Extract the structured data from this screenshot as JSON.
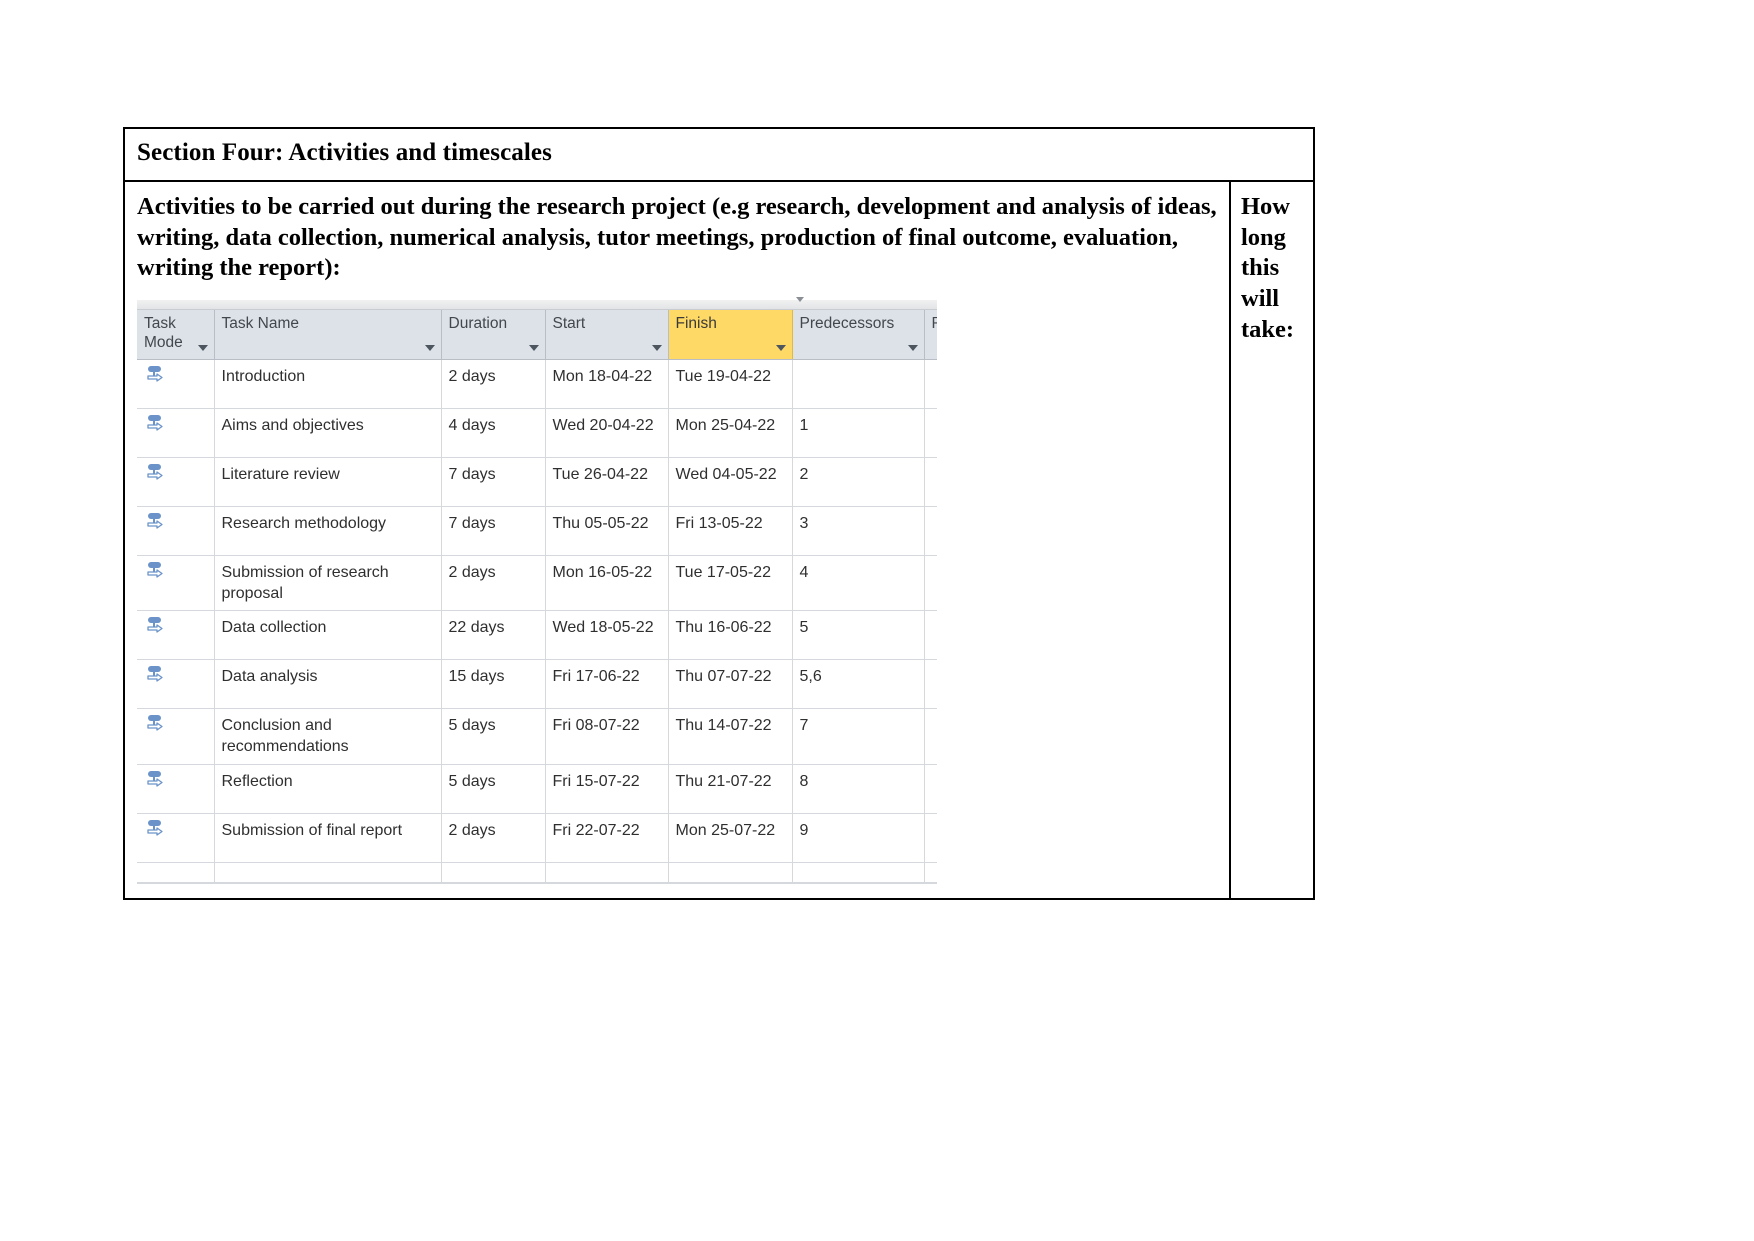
{
  "document": {
    "section_title": "Section Four: Activities and timescales",
    "prompt": "Activities to be carried out during the research project (e.g research, development and analysis of ideas, writing, data collection, numerical analysis, tutor meetings, production of final outcome, evaluation, writing the report):",
    "side_column_heading": "How long this will take:"
  },
  "colors": {
    "header_background": "#dde2e8",
    "finish_highlight": "#ffd966",
    "grid_line": "#d5d8dc",
    "icon_blue": "#6b93c9",
    "document_border": "#000000"
  },
  "project_grid": {
    "columns": [
      {
        "key": "task_mode",
        "label": "Task Mode",
        "has_filter_caret": true,
        "highlighted": false
      },
      {
        "key": "task_name",
        "label": "Task Name",
        "has_filter_caret": true,
        "highlighted": false
      },
      {
        "key": "duration",
        "label": "Duration",
        "has_filter_caret": true,
        "highlighted": false
      },
      {
        "key": "start",
        "label": "Start",
        "has_filter_caret": true,
        "highlighted": false
      },
      {
        "key": "finish",
        "label": "Finish",
        "has_filter_caret": true,
        "highlighted": true
      },
      {
        "key": "predecessors",
        "label": "Predecessors",
        "has_filter_caret": true,
        "highlighted": false
      },
      {
        "key": "cut_off",
        "label": "R",
        "has_filter_caret": false,
        "highlighted": false
      }
    ],
    "task_mode_icon": "manually-scheduled-icon",
    "rows": [
      {
        "id": 1,
        "task_mode": "manually-scheduled-icon",
        "task_name": "Introduction",
        "duration": "2 days",
        "start": "Mon 18-04-22",
        "finish": "Tue 19-04-22",
        "predecessors": ""
      },
      {
        "id": 2,
        "task_mode": "manually-scheduled-icon",
        "task_name": "Aims and objectives",
        "duration": "4 days",
        "start": "Wed 20-04-22",
        "finish": "Mon 25-04-22",
        "predecessors": "1"
      },
      {
        "id": 3,
        "task_mode": "manually-scheduled-icon",
        "task_name": "Literature review",
        "duration": "7 days",
        "start": "Tue 26-04-22",
        "finish": "Wed 04-05-22",
        "predecessors": "2"
      },
      {
        "id": 4,
        "task_mode": "manually-scheduled-icon",
        "task_name": "Research methodology",
        "duration": "7 days",
        "start": "Thu 05-05-22",
        "finish": "Fri 13-05-22",
        "predecessors": "3"
      },
      {
        "id": 5,
        "task_mode": "manually-scheduled-icon",
        "task_name": "Submission of research proposal",
        "duration": "2 days",
        "start": "Mon 16-05-22",
        "finish": "Tue 17-05-22",
        "predecessors": "4"
      },
      {
        "id": 6,
        "task_mode": "manually-scheduled-icon",
        "task_name": "Data collection",
        "duration": "22 days",
        "start": "Wed 18-05-22",
        "finish": "Thu 16-06-22",
        "predecessors": "5"
      },
      {
        "id": 7,
        "task_mode": "manually-scheduled-icon",
        "task_name": "Data analysis",
        "duration": "15 days",
        "start": "Fri 17-06-22",
        "finish": "Thu 07-07-22",
        "predecessors": "5,6"
      },
      {
        "id": 8,
        "task_mode": "manually-scheduled-icon",
        "task_name": "Conclusion and recommendations",
        "duration": "5 days",
        "start": "Fri 08-07-22",
        "finish": "Thu 14-07-22",
        "predecessors": "7"
      },
      {
        "id": 9,
        "task_mode": "manually-scheduled-icon",
        "task_name": "Reflection",
        "duration": "5 days",
        "start": "Fri 15-07-22",
        "finish": "Thu 21-07-22",
        "predecessors": "8"
      },
      {
        "id": 10,
        "task_mode": "manually-scheduled-icon",
        "task_name": "Submission of final report",
        "duration": "2 days",
        "start": "Fri 22-07-22",
        "finish": "Mon 25-07-22",
        "predecessors": "9"
      }
    ]
  }
}
